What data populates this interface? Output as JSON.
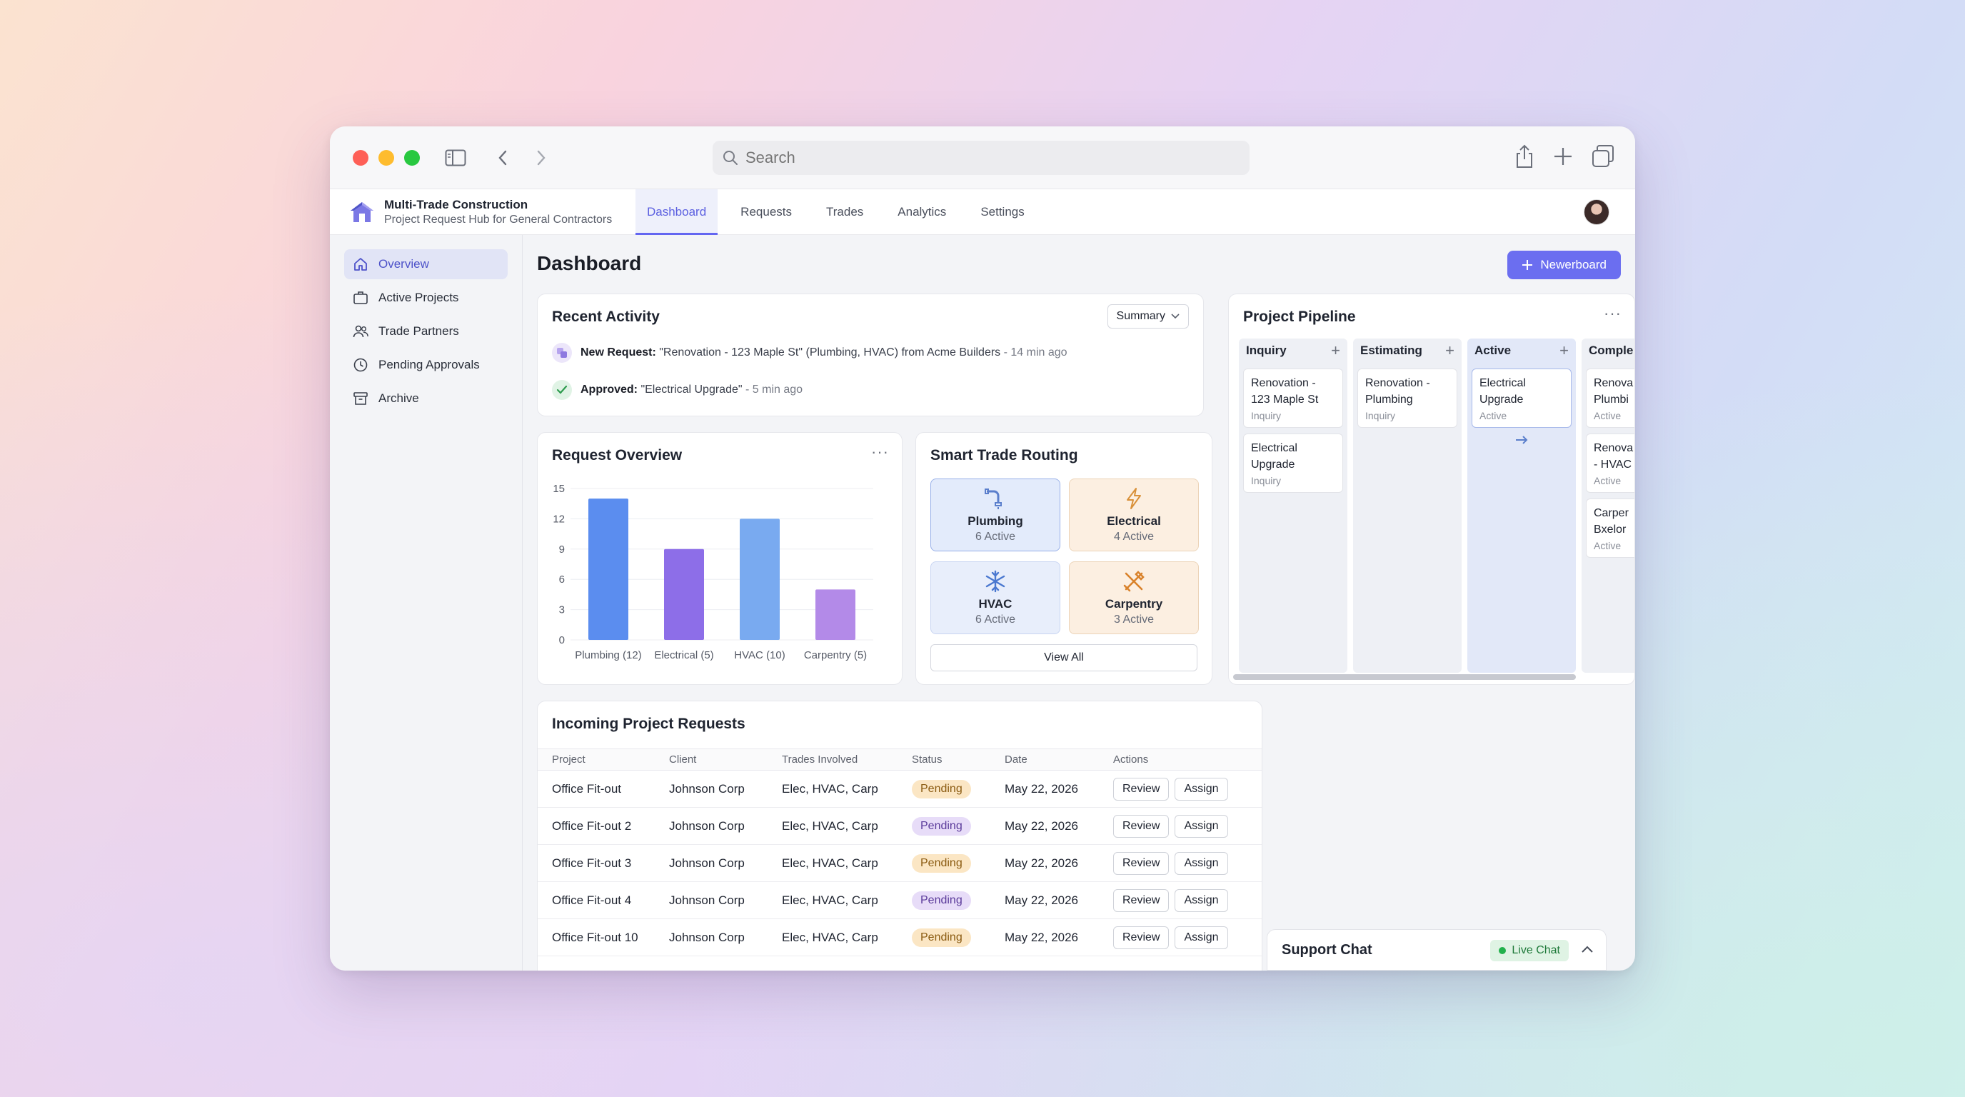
{
  "search": {
    "placeholder": "Search"
  },
  "brand": {
    "title": "Multi-Trade Construction",
    "subtitle": "Project Request Hub for General Contractors"
  },
  "nav": {
    "tabs": [
      "Dashboard",
      "Requests",
      "Trades",
      "Analytics",
      "Settings"
    ],
    "active": "Dashboard"
  },
  "sidebar": {
    "items": [
      "Overview",
      "Active Projects",
      "Trade Partners",
      "Pending Approvals",
      "Archive"
    ],
    "active": "Overview"
  },
  "page": {
    "title": "Dashboard",
    "new_button": "Newerboard"
  },
  "recent_activity": {
    "title": "Recent Activity",
    "filter": "Summary",
    "items": [
      {
        "label": "New Request:",
        "text": "\"Renovation - 123 Maple St\" (Plumbing, HVAC) from Acme Builders",
        "time": "- 14 min ago"
      },
      {
        "label": "Approved:",
        "text": "\"Electrical Upgrade\"",
        "time": "- 5 min ago"
      }
    ]
  },
  "request_overview": {
    "title": "Request Overview"
  },
  "chart_data": {
    "type": "bar",
    "categories": [
      "Plumbing (12)",
      "Electrical (5)",
      "HVAC (10)",
      "Carpentry (5)"
    ],
    "values": [
      14,
      9,
      12,
      5
    ],
    "yticks": [
      0,
      3,
      6,
      9,
      12,
      15
    ],
    "ylim": [
      0,
      15
    ],
    "grid": true,
    "colors": [
      "#5b8def",
      "#8d6ee8",
      "#79aaf0",
      "#b38ae8"
    ]
  },
  "routing": {
    "title": "Smart Trade Routing",
    "tiles": [
      {
        "name": "Plumbing",
        "count": "6 Active",
        "icon": "pipe-icon",
        "color": "#5b7fcc"
      },
      {
        "name": "Electrical",
        "count": "4 Active",
        "icon": "lightning-icon",
        "color": "#d9913a"
      },
      {
        "name": "HVAC",
        "count": "6 Active",
        "icon": "snowflake-icon",
        "color": "#4a78d0"
      },
      {
        "name": "Carpentry",
        "count": "3 Active",
        "icon": "tools-icon",
        "color": "#d9822b"
      }
    ],
    "view_all": "View All"
  },
  "pipeline": {
    "title": "Project Pipeline",
    "columns": [
      {
        "name": "Inquiry",
        "cards": [
          {
            "title": "Renovation - 123 Maple St",
            "status": "Inquiry"
          },
          {
            "title": "Electrical Upgrade",
            "status": "Inquiry"
          }
        ]
      },
      {
        "name": "Estimating",
        "cards": [
          {
            "title": "Renovation - Plumbing",
            "status": "Inquiry"
          }
        ]
      },
      {
        "name": "Active",
        "cards": [
          {
            "title": "Electrical Upgrade",
            "status": "Active"
          }
        ]
      },
      {
        "name": "Comple",
        "cards": [
          {
            "title": "Renova Plumbi",
            "status": "Active"
          },
          {
            "title": "Renova - HVAC",
            "status": "Active"
          },
          {
            "title": "Carper Bxelor",
            "status": "Active"
          }
        ]
      }
    ]
  },
  "requests_table": {
    "title": "Incoming Project Requests",
    "columns": [
      "Project",
      "Client",
      "Trades Involved",
      "Status",
      "Date",
      "Actions"
    ],
    "rows": [
      {
        "project": "Office Fit-out",
        "client": "Johnson Corp",
        "trades": "Elec, HVAC, Carp",
        "status": "Pending",
        "date": "May 22, 2026"
      },
      {
        "project": "Office Fit-out 2",
        "client": "Johnson Corp",
        "trades": "Elec, HVAC, Carp",
        "status": "Pending",
        "date": "May 22, 2026"
      },
      {
        "project": "Office Fit-out 3",
        "client": "Johnson Corp",
        "trades": "Elec, HVAC, Carp",
        "status": "Pending",
        "date": "May 22, 2026"
      },
      {
        "project": "Office Fit-out 4",
        "client": "Johnson Corp",
        "trades": "Elec, HVAC, Carp",
        "status": "Pending",
        "date": "May 22, 2026"
      },
      {
        "project": "Office Fit-out 10",
        "client": "Johnson Corp",
        "trades": "Elec, HVAC, Carp",
        "status": "Pending",
        "date": "May 22, 2026"
      }
    ],
    "review_label": "Review",
    "assign_label": "Assign"
  },
  "support_chat": {
    "title": "Support Chat",
    "status": "Live Chat"
  },
  "colors": {
    "accent": "#6366f1",
    "pending_orange": "#fbe6c4",
    "pending_purple": "#e7dcf8",
    "live_green": "#22b14c"
  }
}
